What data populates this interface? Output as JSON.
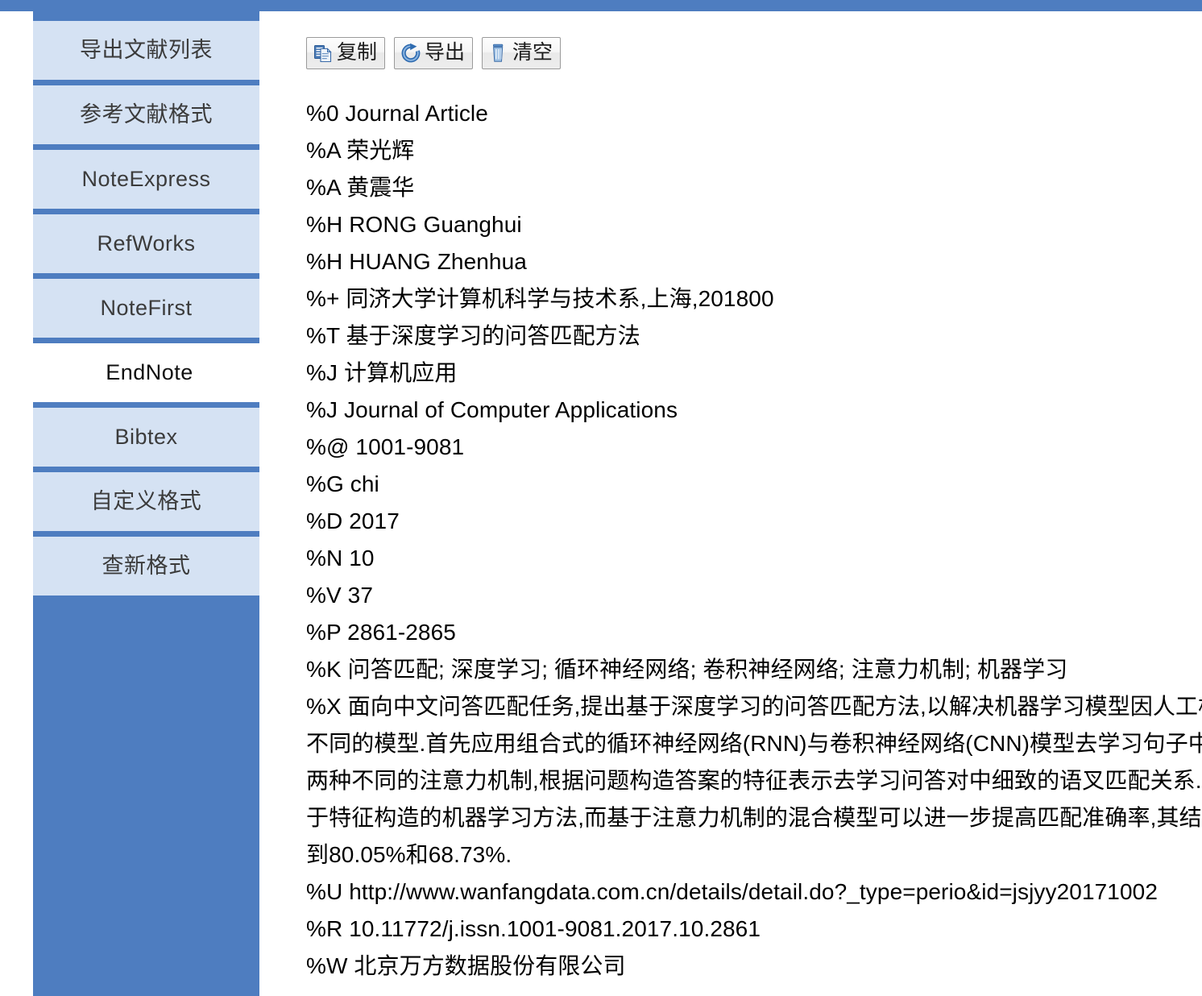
{
  "theme": {
    "band_blue": "#4E7DC0",
    "sidebar_item_blue": "#D5E2F3",
    "active_tab_bg": "#FFFFFF",
    "text_color": "#000000"
  },
  "sidebar": {
    "items": [
      {
        "label": "导出文献列表",
        "name": "sidebar-item-export-list",
        "active": false
      },
      {
        "label": "参考文献格式",
        "name": "sidebar-item-reference-format",
        "active": false
      },
      {
        "label": "NoteExpress",
        "name": "sidebar-item-noteexpress",
        "active": false
      },
      {
        "label": "RefWorks",
        "name": "sidebar-item-refworks",
        "active": false
      },
      {
        "label": "NoteFirst",
        "name": "sidebar-item-notefirst",
        "active": false
      },
      {
        "label": "EndNote",
        "name": "sidebar-item-endnote",
        "active": true
      },
      {
        "label": "Bibtex",
        "name": "sidebar-item-bibtex",
        "active": false
      },
      {
        "label": "自定义格式",
        "name": "sidebar-item-custom-format",
        "active": false
      },
      {
        "label": "查新格式",
        "name": "sidebar-item-novelty-format",
        "active": false
      }
    ]
  },
  "toolbar": {
    "buttons": [
      {
        "label": "复制",
        "icon": "copy-icon",
        "name": "copy-button"
      },
      {
        "label": "导出",
        "icon": "export-refresh-icon",
        "name": "export-button"
      },
      {
        "label": "清空",
        "icon": "trash-icon",
        "name": "clear-button"
      }
    ]
  },
  "document": {
    "format": "EndNote",
    "lines": [
      "%0 Journal Article",
      "%A 荣光辉",
      "%A 黄震华",
      "%H RONG Guanghui",
      "%H HUANG Zhenhua",
      "%+ 同济大学计算机科学与技术系,上海,201800",
      "%T 基于深度学习的问答匹配方法",
      "%J 计算机应用",
      "%J Journal of Computer Applications",
      "%@ 1001-9081",
      "%G chi",
      "%D 2017",
      "%N 10",
      "%V 37",
      "%P 2861-2865",
      "%K 问答匹配; 深度学习; 循环神经网络; 卷积神经网络; 注意力机制; 机器学习",
      "%X 面向中文问答匹配任务,提出基于深度学习的问答匹配方法,以解决机器学习模型因人工构",
      "不同的模型.首先应用组合式的循环神经网络(RNN)与卷积神经网络(CNN)模型去学习句子中",
      "两种不同的注意力机制,根据问题构造答案的特征表示去学习问答对中细致的语叉匹配关系.",
      "于特征构造的机器学习方法,而基于注意力机制的混合模型可以进一步提高匹配准确率,其结",
      "到80.05%和68.73%.",
      "%U http://www.wanfangdata.com.cn/details/detail.do?_type=perio&id=jsjyy20171002",
      "%R 10.11772/j.issn.1001-9081.2017.10.2861",
      "%W 北京万方数据股份有限公司"
    ]
  }
}
